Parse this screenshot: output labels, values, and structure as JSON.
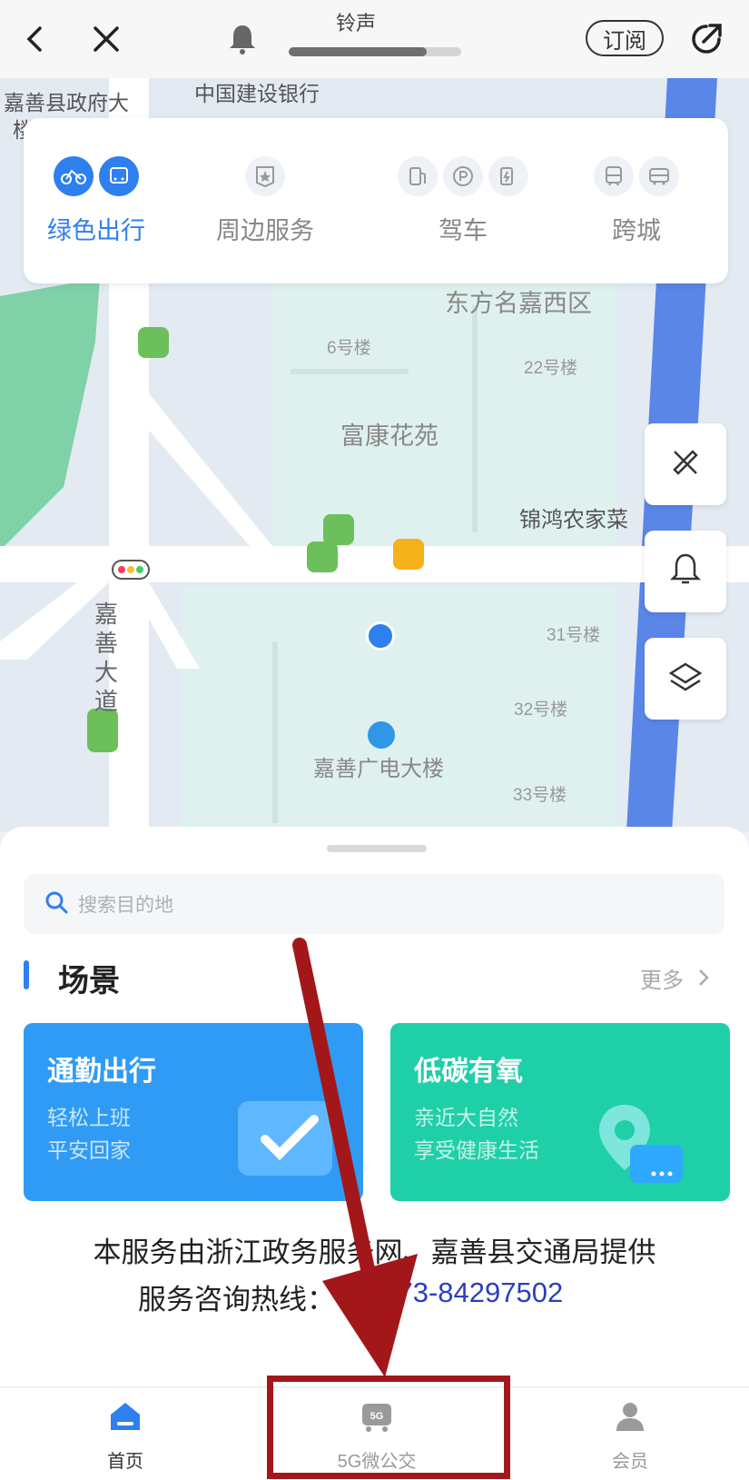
{
  "topbar": {
    "title": "铃声",
    "subscribe_label": "订阅",
    "progress": 0.8
  },
  "map": {
    "labels": {
      "gov": "嘉善县政府大",
      "gov2": "楼",
      "ccb": "中国建设银行",
      "dongfang": "东方名嘉西区",
      "b6": "6号楼",
      "b22": "22号楼",
      "fukang": "富康花苑",
      "jinhong": "锦鸿农家菜",
      "b31": "31号楼",
      "b32": "32号楼",
      "guangdian": "嘉善广电大楼",
      "b33": "33号楼",
      "road": "嘉善大道"
    }
  },
  "categories": [
    {
      "label": "绿色出行",
      "active": true
    },
    {
      "label": "周边服务",
      "active": false
    },
    {
      "label": "驾车",
      "active": false
    },
    {
      "label": "跨城",
      "active": false
    }
  ],
  "search": {
    "placeholder": "搜索目的地"
  },
  "scenes": {
    "title": "场景",
    "more": "更多",
    "cards": [
      {
        "title": "通勤出行",
        "line1": "轻松上班",
        "line2": "平安回家",
        "color": "#2f9bf5"
      },
      {
        "title": "低碳有氧",
        "line1": "亲近大自然",
        "line2": "享受健康生活",
        "color": "#1fcfa8"
      }
    ]
  },
  "footer": {
    "provider": "本服务由浙江政务服务网、嘉善县交通局提供",
    "hotline_label": "服务咨询热线：",
    "hotline_number": "0573-84297502"
  },
  "tabs": [
    {
      "label": "首页",
      "active": true
    },
    {
      "label": "5G微公交",
      "active": false
    },
    {
      "label": "会员",
      "active": false
    }
  ],
  "annotation": {
    "color": "#a3171b"
  }
}
